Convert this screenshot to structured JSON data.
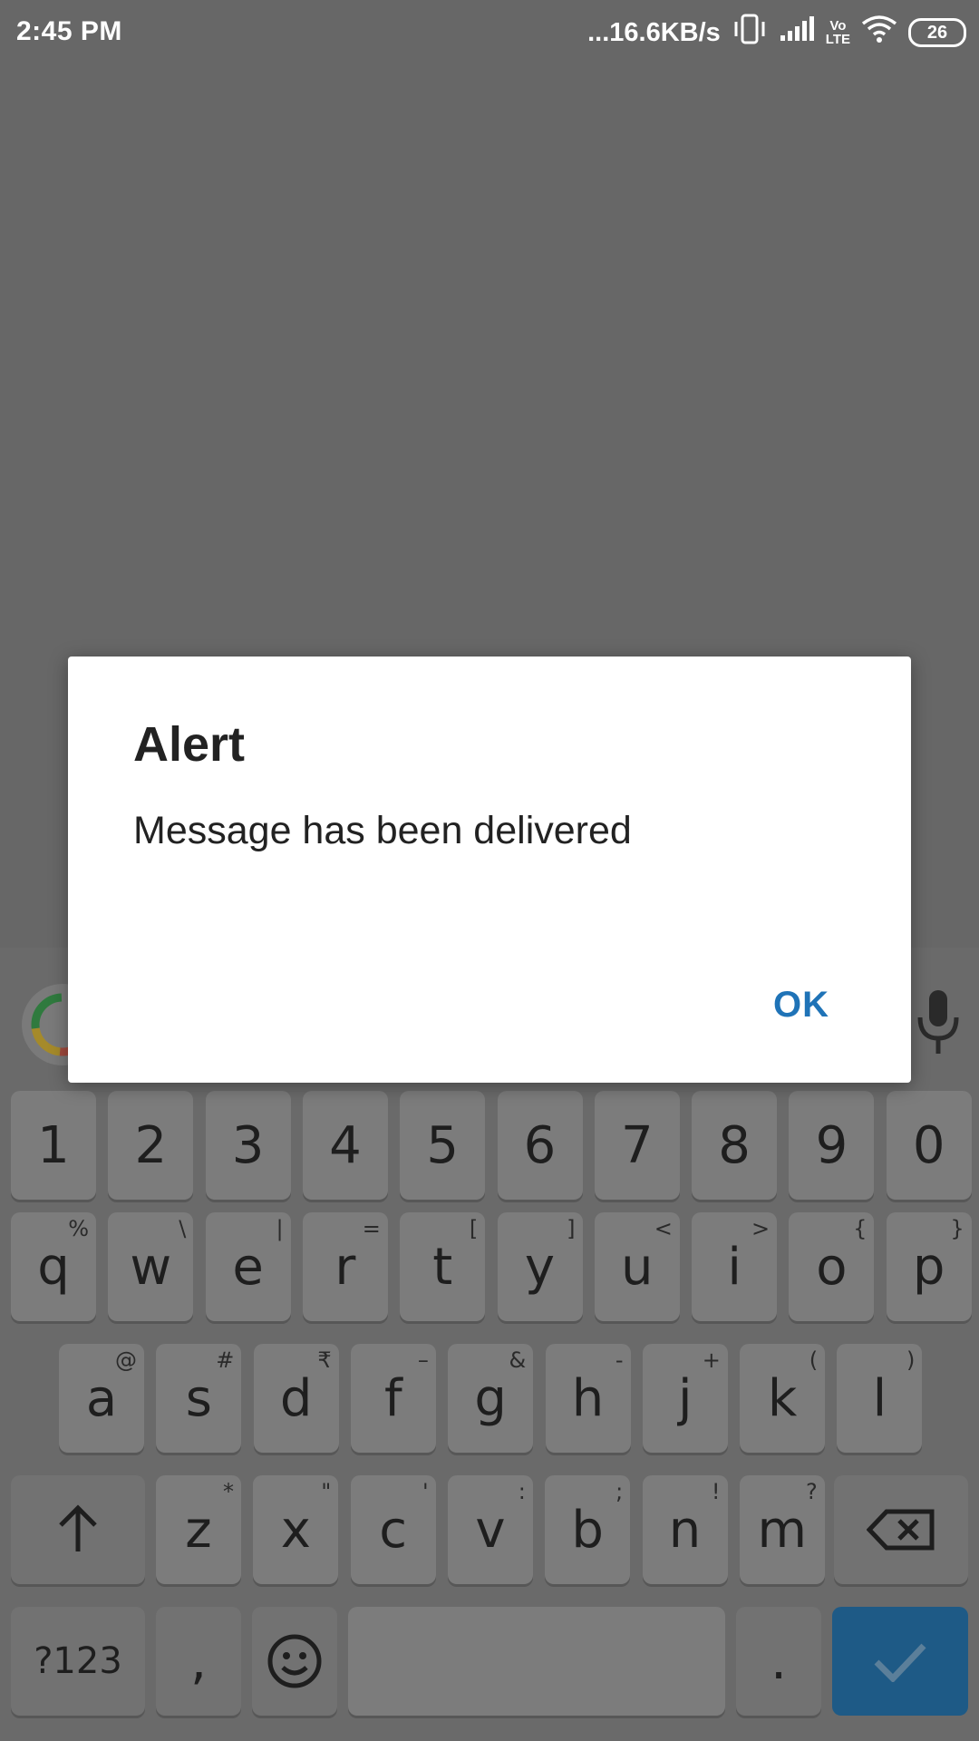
{
  "status_bar": {
    "time": "2:45 PM",
    "net_speed": "...16.6KB/s",
    "volte_label_top": "Vo",
    "volte_label_bottom": "LTE",
    "battery": "26",
    "icons": [
      "vibrate-icon",
      "signal-icon",
      "volte-icon",
      "wifi-icon",
      "battery-icon"
    ]
  },
  "dialog": {
    "title": "Alert",
    "message": "Message has been delivered",
    "ok_label": "OK"
  },
  "keyboard": {
    "number_row": [
      "1",
      "2",
      "3",
      "4",
      "5",
      "6",
      "7",
      "8",
      "9",
      "0"
    ],
    "row1": [
      {
        "key": "q",
        "hint": "%"
      },
      {
        "key": "w",
        "hint": "\\"
      },
      {
        "key": "e",
        "hint": "|"
      },
      {
        "key": "r",
        "hint": "="
      },
      {
        "key": "t",
        "hint": "["
      },
      {
        "key": "y",
        "hint": "]"
      },
      {
        "key": "u",
        "hint": "<"
      },
      {
        "key": "i",
        "hint": ">"
      },
      {
        "key": "o",
        "hint": "{"
      },
      {
        "key": "p",
        "hint": "}"
      }
    ],
    "row2": [
      {
        "key": "a",
        "hint": "@"
      },
      {
        "key": "s",
        "hint": "#"
      },
      {
        "key": "d",
        "hint": "₹"
      },
      {
        "key": "f",
        "hint": "–"
      },
      {
        "key": "g",
        "hint": "&"
      },
      {
        "key": "h",
        "hint": "-"
      },
      {
        "key": "j",
        "hint": "+"
      },
      {
        "key": "k",
        "hint": "("
      },
      {
        "key": "l",
        "hint": ")"
      }
    ],
    "row3": [
      {
        "key": "z",
        "hint": "*"
      },
      {
        "key": "x",
        "hint": "\""
      },
      {
        "key": "c",
        "hint": "'"
      },
      {
        "key": "v",
        "hint": ":"
      },
      {
        "key": "b",
        "hint": ";"
      },
      {
        "key": "n",
        "hint": "!"
      },
      {
        "key": "m",
        "hint": "?"
      }
    ],
    "symbols_label": "?123",
    "comma_label": ",",
    "period_label": ".",
    "accent_color": "#1e5a86"
  }
}
